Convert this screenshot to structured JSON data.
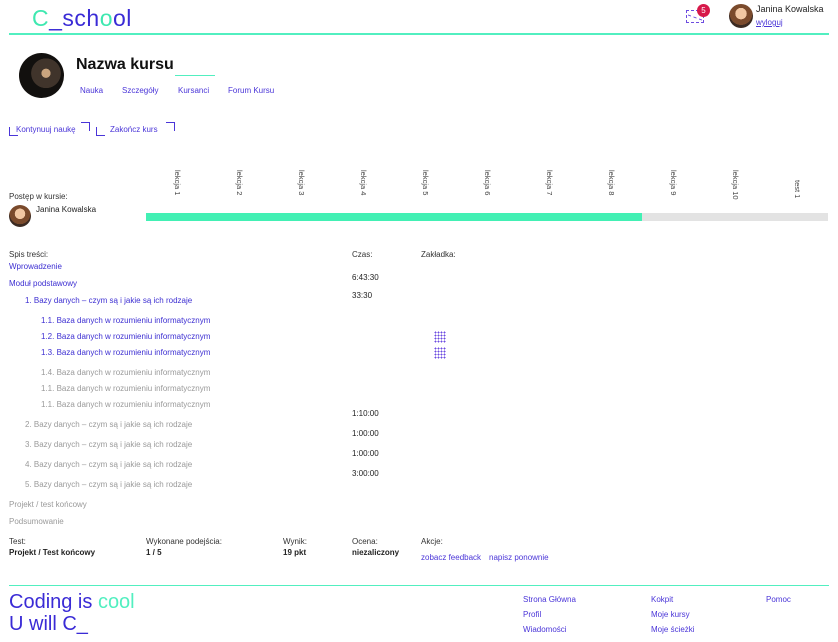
{
  "header": {
    "logo": {
      "first": "C",
      "mid": "_sch",
      "o2": "o",
      "last": "ol"
    },
    "notification_count": "5",
    "user_name": "Janina Kowalska",
    "logout": "wyloguj"
  },
  "course": {
    "title": "Nazwa kursu",
    "tabs": [
      {
        "label": "Nauka",
        "active": false
      },
      {
        "label": "Szczegóły",
        "active": false
      },
      {
        "label": "Kursanci",
        "active": true
      },
      {
        "label": "Forum Kursu",
        "active": false
      }
    ],
    "actions": {
      "continue": "Kontynuuj naukę",
      "finish": "Zakończ kurs"
    }
  },
  "progress": {
    "label": "Postęp w kursie:",
    "user_name": "Janina Kowalska",
    "lessons": [
      "lekcja 1",
      "lekcja 2",
      "lekcja 3",
      "lekcja 4",
      "lekcja 5",
      "lekcja 6",
      "lekcja 7",
      "lekcja 8",
      "lekcja 9",
      "lekcja 10",
      "test 1"
    ],
    "completed_fraction": 0.727
  },
  "toc": {
    "headers": {
      "contents": "Spis treści:",
      "time": "Czas:",
      "bookmark": "Zakładka:"
    },
    "items": [
      {
        "text": "Wprowadzenie",
        "state": "active"
      },
      {
        "text": "Moduł podstawowy",
        "state": "active"
      },
      {
        "text": "1. Bazy danych – czym są i jakie są ich rodzaje",
        "state": "active"
      },
      {
        "text": "1.1. Baza danych w rozumieniu informatycznym",
        "state": "active"
      },
      {
        "text": "1.2. Baza danych w rozumieniu informatycznym",
        "state": "active"
      },
      {
        "text": "1.3. Baza danych w rozumieniu informatycznym",
        "state": "active"
      },
      {
        "text": "1.4. Baza danych w rozumieniu informatycznym",
        "state": "inactive"
      },
      {
        "text": "1.1. Baza danych w rozumieniu informatycznym",
        "state": "inactive"
      },
      {
        "text": "1.1. Baza danych w rozumieniu informatycznym",
        "state": "inactive"
      },
      {
        "text": "2. Bazy danych – czym są i jakie są ich rodzaje",
        "state": "inactive"
      },
      {
        "text": "3. Bazy danych – czym są i jakie są ich rodzaje",
        "state": "inactive"
      },
      {
        "text": "4. Bazy danych – czym są i jakie są ich rodzaje",
        "state": "inactive"
      },
      {
        "text": "5. Bazy danych – czym są i jakie są ich rodzaje",
        "state": "inactive"
      },
      {
        "text": "Projekt / test końcowy",
        "state": "inactive"
      },
      {
        "text": "Podsumowanie",
        "state": "inactive"
      }
    ],
    "times": [
      "6:43:30",
      "33:30",
      "1:10:00",
      "1:00:00",
      "1:00:00",
      "3:00:00"
    ]
  },
  "test": {
    "headers": {
      "test": "Test:",
      "attempts": "Wykonane podejścia:",
      "result": "Wynik:",
      "grade": "Ocena:",
      "actions": "Akcje:"
    },
    "name": "Projekt / Test końcowy",
    "attempts": "1 / 5",
    "result": "19 pkt",
    "grade": "niezaliczony",
    "links": {
      "feedback": "zobacz feedback",
      "retry": "napisz ponownie"
    }
  },
  "footer": {
    "slogan_a": "Coding is ",
    "slogan_cool": "cool",
    "slogan_b": "U will C_",
    "links_col1": [
      "Strona Główna",
      "Profil",
      "Wiadomości"
    ],
    "links_col2": [
      "Kokpit",
      "Moje kursy",
      "Moje ścieżki"
    ],
    "links_col3": [
      "Pomoc"
    ]
  },
  "colors": {
    "brand": "#3a2bd6",
    "accent": "#52efc0",
    "badge": "#d7194a",
    "progress": "#42f0b4"
  }
}
